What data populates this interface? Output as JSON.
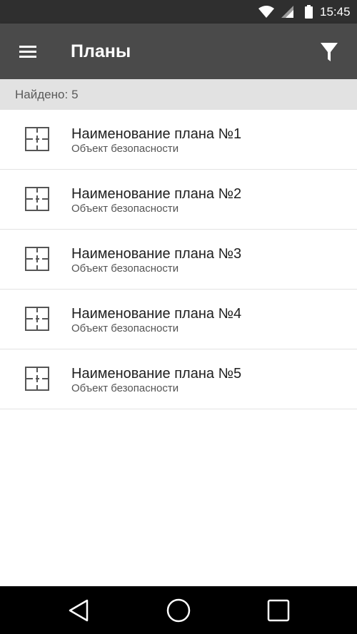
{
  "status_bar": {
    "time": "15:45",
    "icons": [
      "wifi-icon",
      "signal-icon",
      "battery-icon"
    ]
  },
  "app_bar": {
    "title": "Планы",
    "menu_icon": "menu-icon",
    "filter_icon": "filter-icon"
  },
  "results": {
    "label": "Найдено:",
    "count": "5"
  },
  "plans": [
    {
      "title": "Наименование плана №1",
      "subtitle": "Объект безопасности",
      "icon": "floor-plan-icon"
    },
    {
      "title": "Наименование плана №2",
      "subtitle": "Объект безопасности",
      "icon": "floor-plan-icon"
    },
    {
      "title": "Наименование плана №3",
      "subtitle": "Объект безопасности",
      "icon": "floor-plan-icon"
    },
    {
      "title": "Наименование плана №4",
      "subtitle": "Объект безопасности",
      "icon": "floor-plan-icon"
    },
    {
      "title": "Наименование плана №5",
      "subtitle": "Объект безопасности",
      "icon": "floor-plan-icon"
    }
  ],
  "nav_bar": {
    "icons": [
      "back-icon",
      "home-icon",
      "recents-icon"
    ]
  },
  "colors": {
    "status_bar": "#2f2f2f",
    "app_bar": "#4a4a4a",
    "found_bar": "#e2e2e2",
    "nav_bar": "#000000"
  }
}
